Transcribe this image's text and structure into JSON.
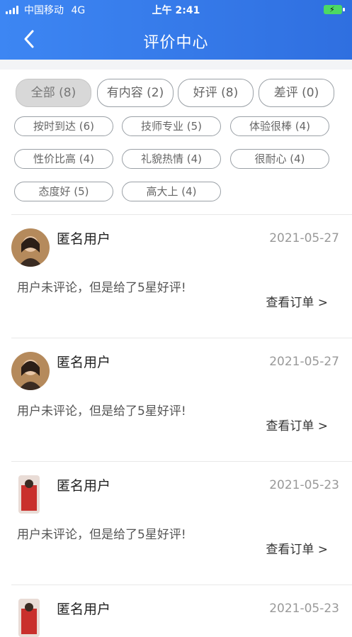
{
  "status": {
    "carrier": "中国移动",
    "network": "4G",
    "time": "上午 2:41"
  },
  "header": {
    "title": "评价中心"
  },
  "filters_primary": [
    {
      "label": "全部 (8)"
    },
    {
      "label": "有内容 (2)"
    },
    {
      "label": "好评 (8)"
    },
    {
      "label": "差评 (0)"
    }
  ],
  "filters_tags": [
    {
      "label": "按时到达 (6)"
    },
    {
      "label": "技师专业 (5)"
    },
    {
      "label": "体验很棒 (4)"
    },
    {
      "label": "性价比高 (4)"
    },
    {
      "label": "礼貌热情 (4)"
    },
    {
      "label": "很耐心 (4)"
    },
    {
      "label": "态度好 (5)"
    },
    {
      "label": "高大上 (4)"
    }
  ],
  "reviews": [
    {
      "user": "匿名用户",
      "date": "2021-05-27",
      "text": "用户未评论，但是给了5星好评!",
      "link": "查看订单 >"
    },
    {
      "user": "匿名用户",
      "date": "2021-05-27",
      "text": "用户未评论，但是给了5星好评!",
      "link": "查看订单 >"
    },
    {
      "user": "匿名用户",
      "date": "2021-05-23",
      "text": "用户未评论，但是给了5星好评!",
      "link": "查看订单 >"
    },
    {
      "user": "匿名用户",
      "date": "2021-05-23"
    }
  ],
  "colors": {
    "header_from": "#3d86f3",
    "header_to": "#2f6fe0",
    "chip_selected": "#d8d8d8"
  }
}
